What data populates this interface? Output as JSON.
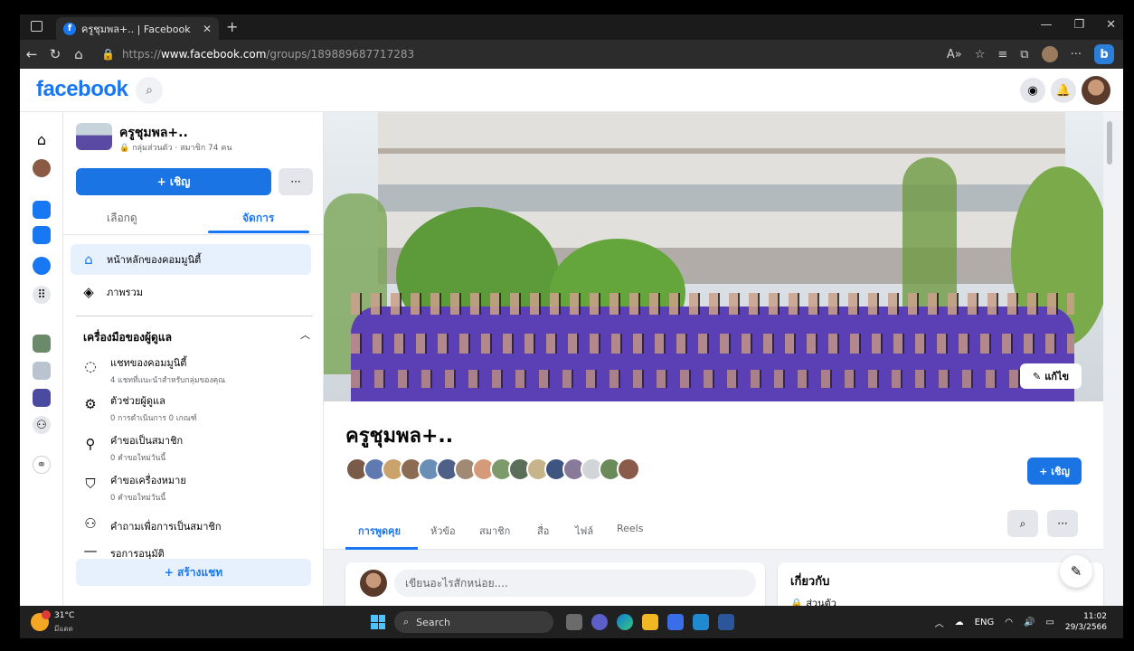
{
  "browser": {
    "tab_title": "ครูชุมพล+.. | Facebook",
    "url_prefix": "https://",
    "url_host": "www.facebook.com",
    "url_path": "/groups/189889687717283"
  },
  "header": {
    "logo": "facebook"
  },
  "sidebar": {
    "group_name": "ครูชุมพล+..",
    "group_meta": "กลุ่มส่วนตัว · สมาชิก 74 คน",
    "invite_label": "+ เชิญ",
    "more_label": "···",
    "tabs": [
      {
        "label": "เลือกดู"
      },
      {
        "label": "จัดการ"
      }
    ],
    "nav": [
      {
        "label": "หน้าหลักของคอมมูนิตี้"
      },
      {
        "label": "ภาพรวม"
      }
    ],
    "admin_tools_title": "เครื่องมือของผู้ดูแล",
    "tools": [
      {
        "title": "แชทของคอมมูนิตี้",
        "sub": "4 แชทที่แนะนำสำหรับกลุ่มของคุณ"
      },
      {
        "title": "ตัวช่วยผู้ดูแล",
        "sub": "0 การดำเนินการ 0 เกณฑ์"
      },
      {
        "title": "คำขอเป็นสมาชิก",
        "sub": "0 คำขอใหม่วันนี้"
      },
      {
        "title": "คำขอเครื่องหมาย",
        "sub": "0 คำขอใหม่วันนี้"
      },
      {
        "title": "คำถามเพื่อการเป็นสมาชิก",
        "sub": ""
      },
      {
        "title": "รอการอนุมัติ",
        "sub": ""
      }
    ],
    "create_chat_label": "+ สร้างแชท"
  },
  "main": {
    "edit_cover_label": "แก้ไข",
    "title": "ครูชุมพล+..",
    "invite_label": "+ เชิญ",
    "tabs": [
      {
        "label": "การพูดคุย"
      },
      {
        "label": "หัวข้อ"
      },
      {
        "label": "สมาชิก"
      },
      {
        "label": "สื่อ"
      },
      {
        "label": "ไฟล์"
      },
      {
        "label": "Reels"
      }
    ],
    "more_label": "···",
    "composer_placeholder": "เขียนอะไรสักหน่อย....",
    "about_title": "เกี่ยวกับ",
    "about_privacy": "ส่วนตัว"
  },
  "taskbar": {
    "weather_temp": "31°C",
    "weather_desc": "มีแดด",
    "search_label": "Search",
    "lang": "ENG",
    "time": "11:02",
    "date": "29/3/2566"
  },
  "colors": {
    "brand": "#1877f2",
    "active_bg": "#e7f0fd",
    "shirt_purple": "#5b3fb5"
  }
}
